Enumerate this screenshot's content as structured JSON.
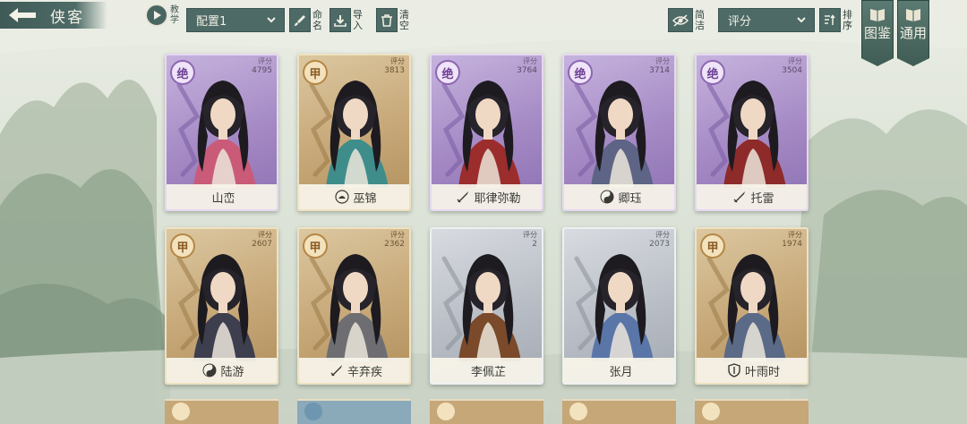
{
  "header": {
    "title": "侠客",
    "tutorial_label": "教学",
    "config_select": "配置1",
    "rename_label": "命名",
    "import_label": "导入",
    "clear_label": "清空",
    "simple_label": "简洁",
    "score_select": "评分",
    "sort_label": "排序"
  },
  "side_tabs": [
    {
      "label": "图鉴"
    },
    {
      "label": "通用"
    }
  ],
  "score_label": "评分",
  "cards": [
    {
      "name": "山峦",
      "rank": "绝",
      "score": "4795",
      "tier": "purple",
      "faction": "",
      "accent": "#c95b78"
    },
    {
      "name": "巫锦",
      "rank": "甲",
      "score": "3813",
      "tier": "gold",
      "faction": "lotus-icon",
      "accent": "#3f8d8b"
    },
    {
      "name": "耶律弥勒",
      "rank": "绝",
      "score": "3764",
      "tier": "purple",
      "faction": "blade-icon",
      "accent": "#9b2d2d"
    },
    {
      "name": "卿珏",
      "rank": "绝",
      "score": "3714",
      "tier": "purple",
      "faction": "yinyang-icon",
      "accent": "#5d6486"
    },
    {
      "name": "托雷",
      "rank": "绝",
      "score": "3504",
      "tier": "purple",
      "faction": "blade-icon",
      "accent": "#8e2a2a"
    },
    {
      "name": "陆游",
      "rank": "甲",
      "score": "2607",
      "tier": "gold",
      "faction": "yinyang-icon",
      "accent": "#3d3f4f"
    },
    {
      "name": "辛弃疾",
      "rank": "甲",
      "score": "2362",
      "tier": "gold",
      "faction": "blade-icon",
      "accent": "#6e6e72"
    },
    {
      "name": "李佩芷",
      "rank": "",
      "score": "2",
      "tier": "silver",
      "faction": "",
      "accent": "#7a4a2a"
    },
    {
      "name": "张月",
      "rank": "",
      "score": "2073",
      "tier": "silver",
      "faction": "",
      "accent": "#5a75a8"
    },
    {
      "name": "叶雨时",
      "rank": "甲",
      "score": "1974",
      "tier": "gold",
      "faction": "shield-icon",
      "accent": "#5b6a86"
    }
  ],
  "colors": {
    "bar": "#4d6a66",
    "purple_card": "#a489c4",
    "gold_card": "#c6a777",
    "silver_card": "#b9bec6"
  }
}
